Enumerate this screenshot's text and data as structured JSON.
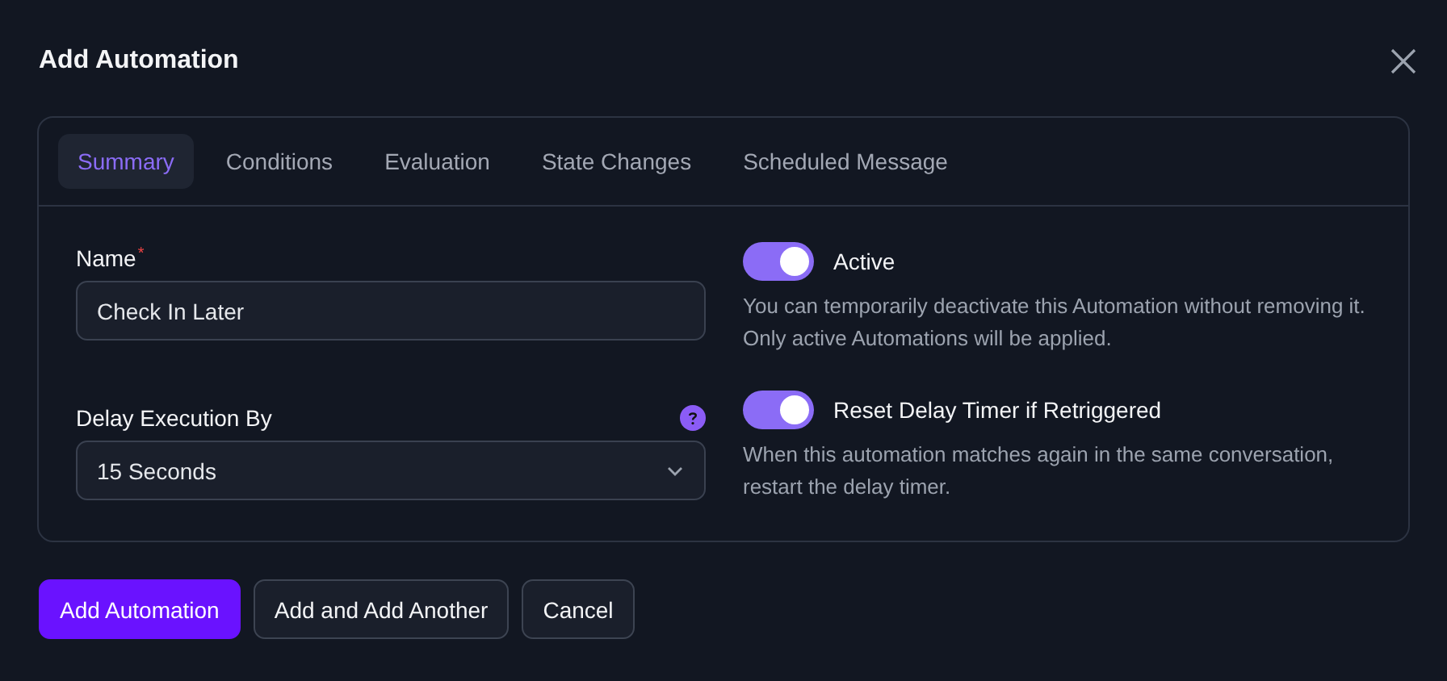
{
  "dialog": {
    "title": "Add Automation"
  },
  "tabs": [
    {
      "label": "Summary",
      "selected": true
    },
    {
      "label": "Conditions",
      "selected": false
    },
    {
      "label": "Evaluation",
      "selected": false
    },
    {
      "label": "State Changes",
      "selected": false
    },
    {
      "label": "Scheduled Message",
      "selected": false
    }
  ],
  "fields": [
    {
      "kind": "text",
      "label": "Name",
      "required_mark": "*",
      "value": "Check In Later",
      "help": false
    },
    {
      "kind": "select",
      "label": "Delay Execution By",
      "value": "15 Seconds",
      "help": true
    }
  ],
  "toggles": [
    {
      "label": "Active",
      "on": true,
      "description": "You can temporarily deactivate this Automation without removing it. Only active Automations will be applied."
    },
    {
      "label": "Reset Delay Timer if Retriggered",
      "on": true,
      "description": "When this automation matches again in the same conversation, restart the delay timer."
    }
  ],
  "buttons": [
    {
      "label": "Add Automation",
      "kind": "primary"
    },
    {
      "label": "Add and Add Another",
      "kind": "secondary"
    },
    {
      "label": "Cancel",
      "kind": "secondary"
    }
  ]
}
